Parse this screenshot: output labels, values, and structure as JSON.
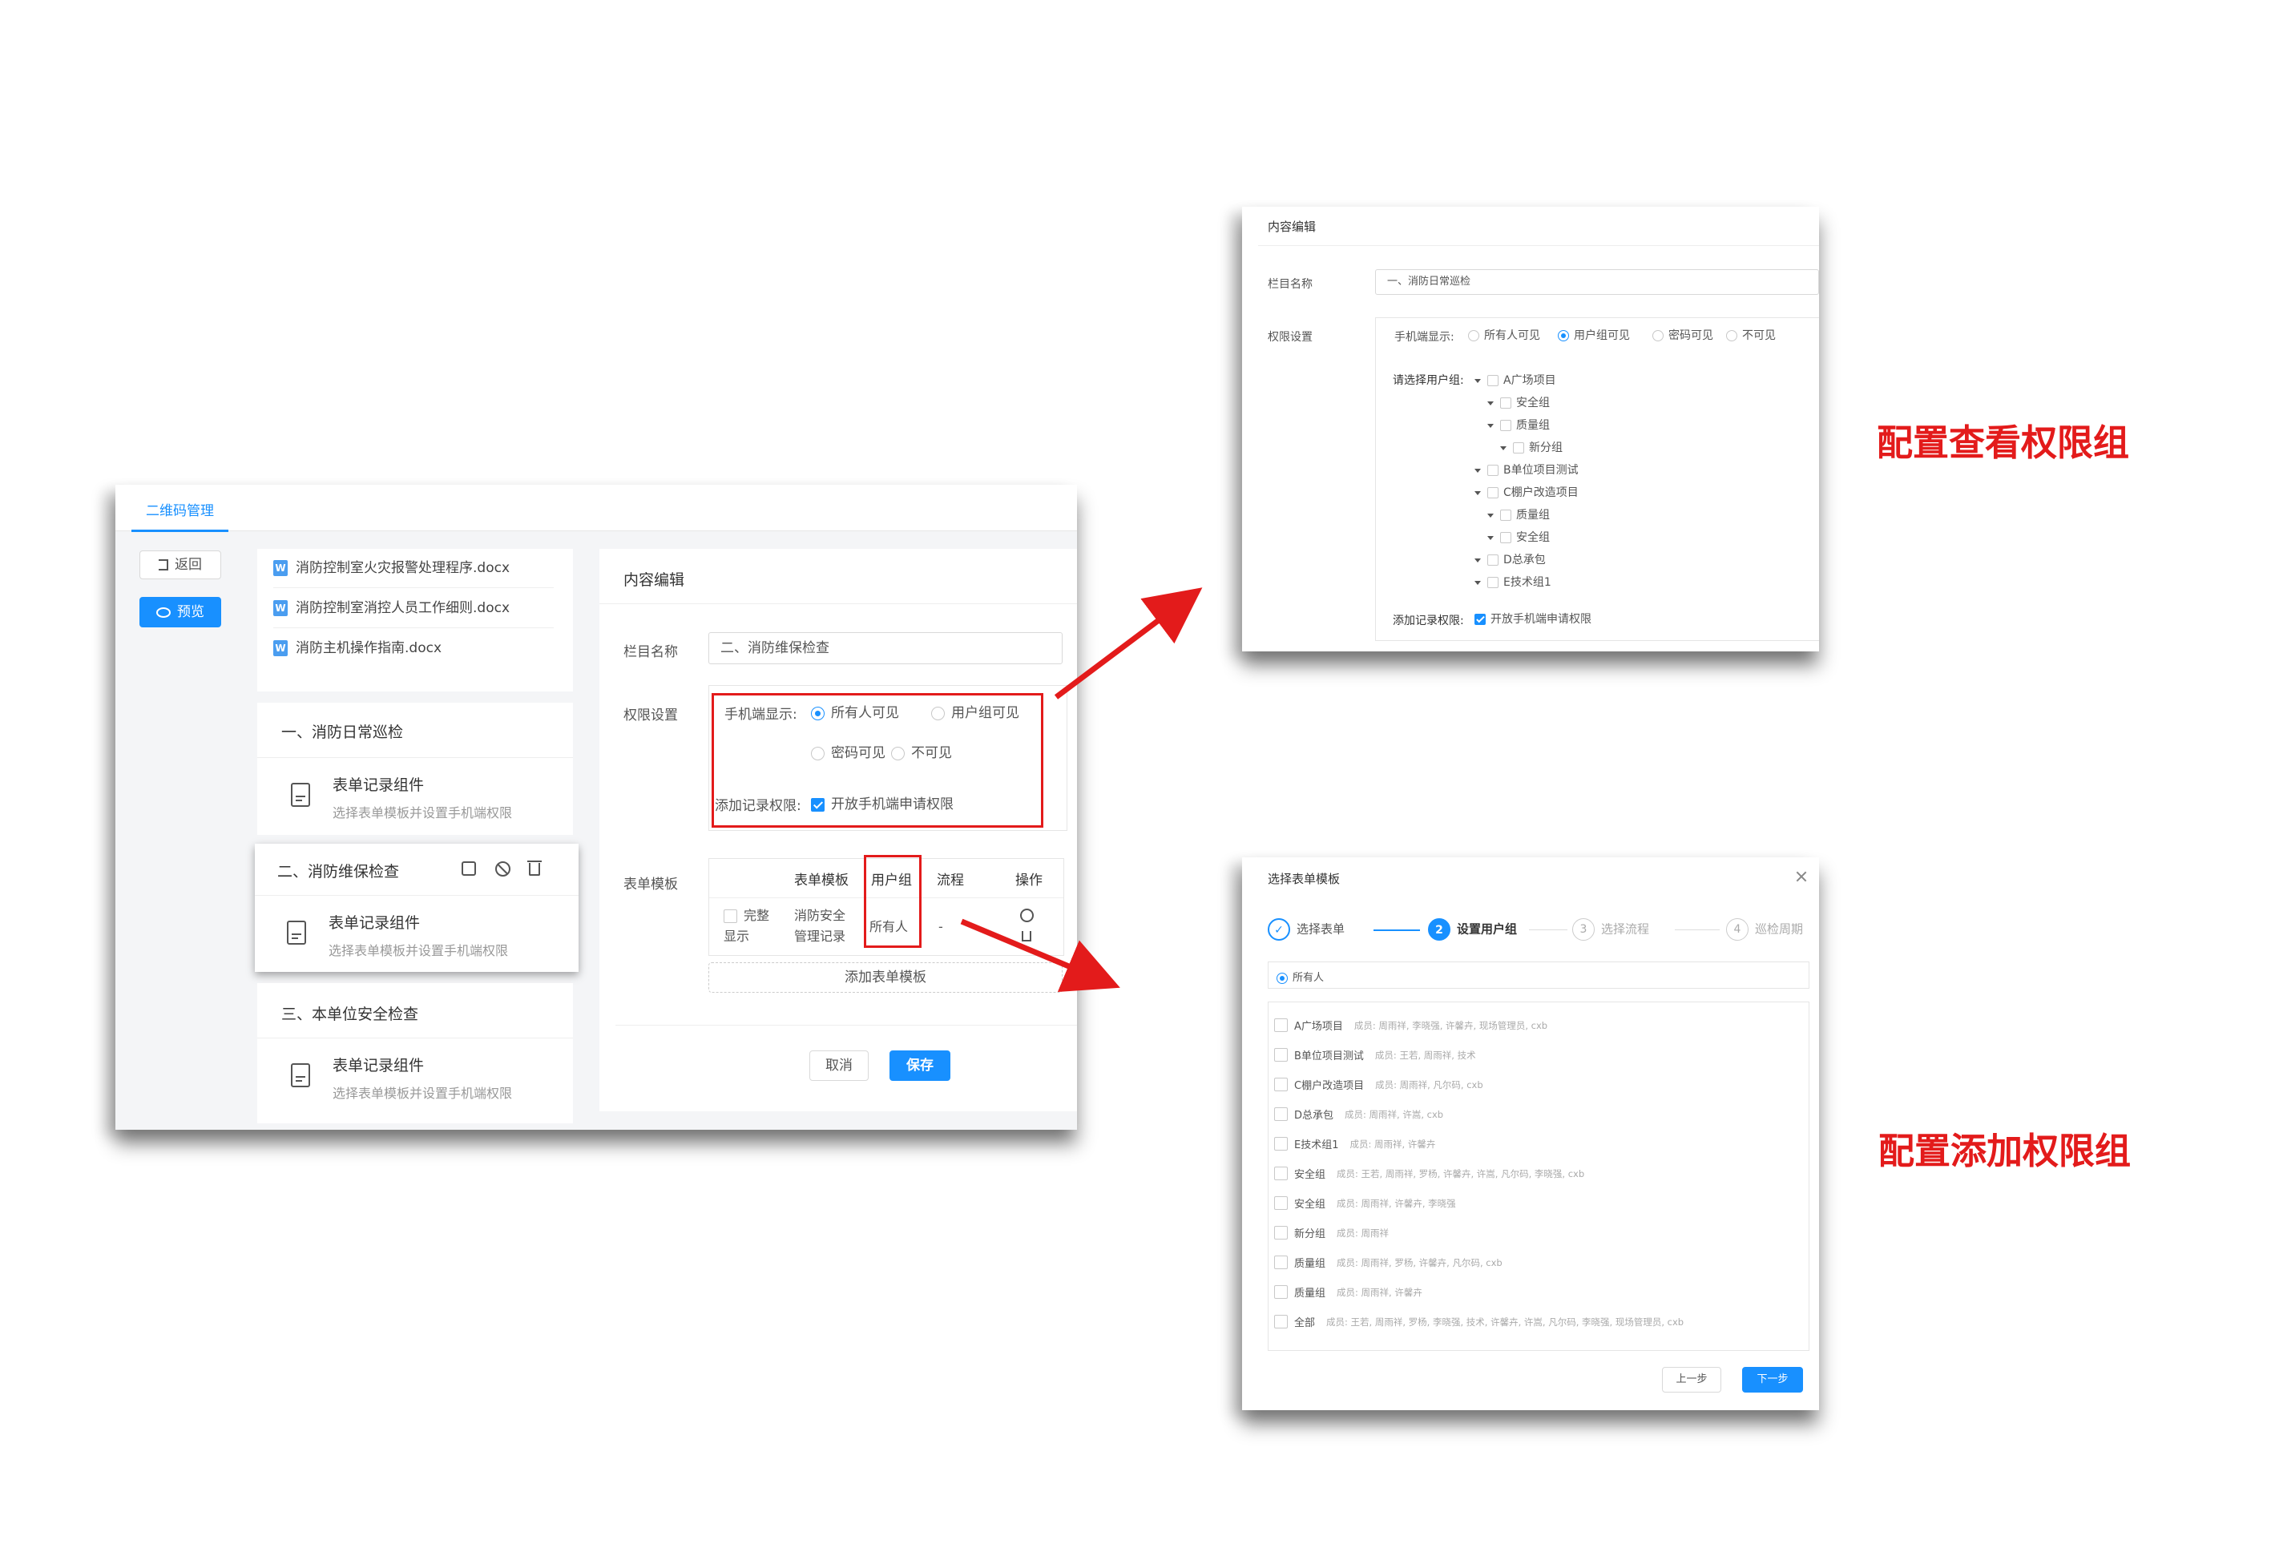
{
  "main": {
    "tab": "二维码管理",
    "back_label": "返回",
    "preview_label": "预览",
    "files": [
      "消防控制室火灾报警处理程序.docx",
      "消防控制室消控人员工作细则.docx",
      "消防主机操作指南.docx"
    ],
    "file_icon": "W",
    "sections": [
      {
        "title": "一、消防日常巡检",
        "component": "表单记录组件",
        "hint": "选择表单模板并设置手机端权限"
      },
      {
        "title": "二、消防维保检查",
        "component": "表单记录组件",
        "hint": "选择表单模板并设置手机端权限"
      },
      {
        "title": "三、本单位安全检查",
        "component": "表单记录组件",
        "hint": "选择表单模板并设置手机端权限"
      }
    ],
    "editor": {
      "heading": "内容编辑",
      "name_label": "栏目名称",
      "name_value": "二、消防维保检查",
      "perm_label": "权限设置",
      "mobile_label": "手机端显示:",
      "mobile_options": [
        "所有人可见",
        "用户组可见",
        "密码可见",
        "不可见"
      ],
      "mobile_selected": "所有人可见",
      "add_label": "添加记录权限:",
      "add_option": "开放手机端申请权限",
      "template_label": "表单模板",
      "table_headers": [
        "表单模板",
        "用户组",
        "流程",
        "操作"
      ],
      "row": {
        "check_label": "完整显示",
        "template": "消防安全管理记录",
        "group": "所有人",
        "flow": "-"
      },
      "add_template": "添加表单模板",
      "cancel": "取消",
      "save": "保存"
    }
  },
  "view_panel": {
    "heading": "内容编辑",
    "name_label": "栏目名称",
    "name_value": "一、消防日常巡检",
    "perm_label": "权限设置",
    "mobile_label": "手机端显示:",
    "mobile_options": [
      "所有人可见",
      "用户组可见",
      "密码可见",
      "不可见"
    ],
    "mobile_selected": "用户组可见",
    "group_label": "请选择用户组:",
    "tree": [
      "A广场项目",
      "安全组",
      "质量组",
      "新分组",
      "B单位项目测试",
      "C棚户改造项目",
      "质量组",
      "安全组",
      "D总承包",
      "E技术组1"
    ],
    "add_label": "添加记录权限:",
    "add_option": "开放手机端申请权限"
  },
  "select_panel": {
    "title": "选择表单模板",
    "steps": [
      {
        "num": "1",
        "label": "选择表单"
      },
      {
        "num": "2",
        "label": "设置用户组"
      },
      {
        "num": "3",
        "label": "选择流程"
      },
      {
        "num": "4",
        "label": "巡检周期"
      }
    ],
    "all_label": "所有人",
    "groups": [
      {
        "name": "A广场项目",
        "members": "成员: 周雨祥, 李晓强, 许馨卉, 现场管理员, cxb"
      },
      {
        "name": "B单位项目测试",
        "members": "成员: 王若, 周雨祥, 技术"
      },
      {
        "name": "C棚户改造项目",
        "members": "成员: 周雨祥, 凡尔码, cxb"
      },
      {
        "name": "D总承包",
        "members": "成员: 周雨祥, 许嵩, cxb"
      },
      {
        "name": "E技术组1",
        "members": "成员: 周雨祥, 许馨卉"
      },
      {
        "name": "安全组",
        "members": "成员: 王若, 周雨祥, 罗杨, 许馨卉, 许嵩, 凡尔码, 李晓强, cxb"
      },
      {
        "name": "安全组",
        "members": "成员: 周雨祥, 许馨卉, 李晓强"
      },
      {
        "name": "新分组",
        "members": "成员: 周雨祥"
      },
      {
        "name": "质量组",
        "members": "成员: 周雨祥, 罗杨, 许馨卉, 凡尔码, cxb"
      },
      {
        "name": "质量组",
        "members": "成员: 周雨祥, 许馨卉"
      },
      {
        "name": "全部",
        "members": "成员: 王若, 周雨祥, 罗杨, 李晓强, 技术, 许馨卉, 许嵩, 凡尔码, 李晓强, 现场管理员, cxb"
      }
    ],
    "prev": "上一步",
    "next": "下一步"
  },
  "annotations": {
    "view": "配置查看权限组",
    "add": "配置添加权限组"
  },
  "colors": {
    "accent": "#1890ff",
    "annotation": "#e31b1b"
  }
}
